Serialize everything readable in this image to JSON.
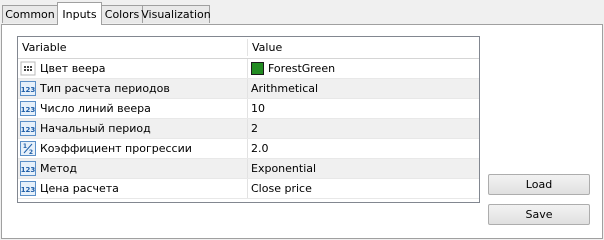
{
  "tabs": [
    {
      "label": "Common"
    },
    {
      "label": "Inputs"
    },
    {
      "label": "Colors"
    },
    {
      "label": "Visualization"
    }
  ],
  "grid": {
    "col_variable": "Variable",
    "col_value": "Value",
    "rows": [
      {
        "icon": "color-dots-icon",
        "name": "Цвет веера",
        "value": "ForestGreen",
        "swatch": "#228b22"
      },
      {
        "icon": "integer-123-icon",
        "name": "Тип расчета периодов",
        "value": "Arithmetical"
      },
      {
        "icon": "integer-123-icon",
        "name": "Число линий веера",
        "value": "10"
      },
      {
        "icon": "integer-123-icon",
        "name": "Начальный период",
        "value": "2"
      },
      {
        "icon": "fraction-icon",
        "name": "Коэффициент прогрессии",
        "value": "2.0"
      },
      {
        "icon": "integer-123-icon",
        "name": "Метод",
        "value": "Exponential"
      },
      {
        "icon": "integer-123-icon",
        "name": "Цена расчета",
        "value": "Close price"
      }
    ]
  },
  "buttons": {
    "load": "Load",
    "save": "Save"
  }
}
